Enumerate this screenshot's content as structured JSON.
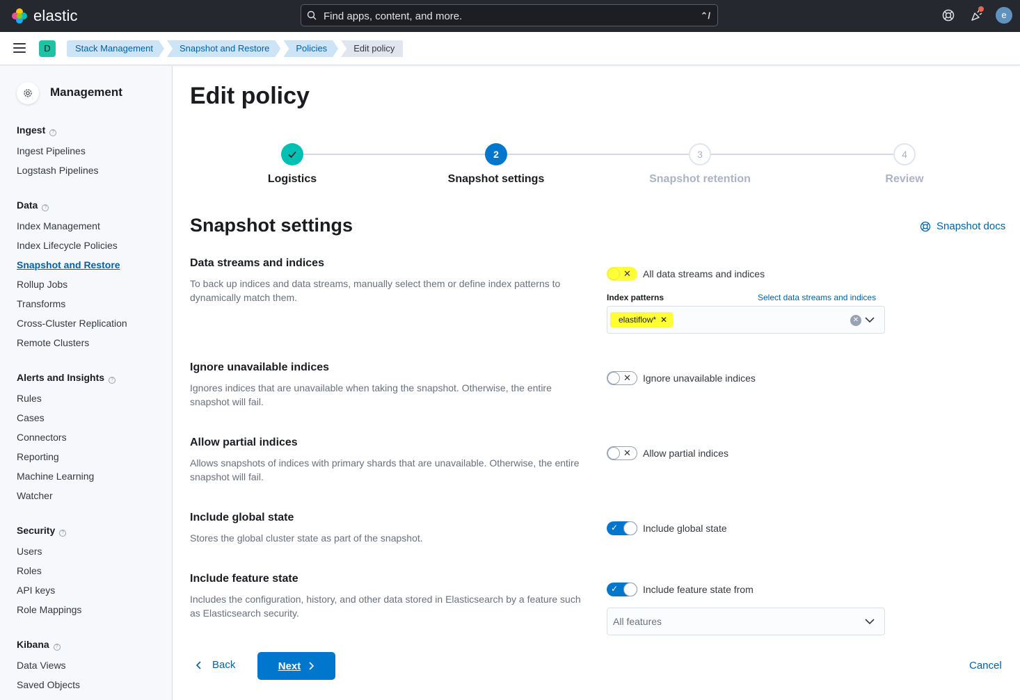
{
  "header": {
    "brand": "elastic",
    "search_placeholder": "Find apps, content, and more.",
    "search_shortcut": "⌃/",
    "avatar_initial": "e",
    "icons": [
      "help-icon",
      "newsfeed-icon",
      "user-avatar"
    ]
  },
  "subbar": {
    "space_initial": "D",
    "breadcrumbs": [
      "Stack Management",
      "Snapshot and Restore",
      "Policies",
      "Edit policy"
    ]
  },
  "sidebar": {
    "title": "Management",
    "groups": [
      {
        "label": "Ingest",
        "items": [
          "Ingest Pipelines",
          "Logstash Pipelines"
        ]
      },
      {
        "label": "Data",
        "items": [
          "Index Management",
          "Index Lifecycle Policies",
          "Snapshot and Restore",
          "Rollup Jobs",
          "Transforms",
          "Cross-Cluster Replication",
          "Remote Clusters"
        ]
      },
      {
        "label": "Alerts and Insights",
        "items": [
          "Rules",
          "Cases",
          "Connectors",
          "Reporting",
          "Machine Learning",
          "Watcher"
        ]
      },
      {
        "label": "Security",
        "items": [
          "Users",
          "Roles",
          "API keys",
          "Role Mappings"
        ]
      },
      {
        "label": "Kibana",
        "items": [
          "Data Views",
          "Saved Objects"
        ]
      }
    ],
    "active_item": "Snapshot and Restore"
  },
  "main": {
    "title": "Edit policy",
    "steps": [
      {
        "number": "1",
        "label": "Logistics",
        "status": "complete"
      },
      {
        "number": "2",
        "label": "Snapshot settings",
        "status": "current"
      },
      {
        "number": "3",
        "label": "Snapshot retention",
        "status": "incomplete"
      },
      {
        "number": "4",
        "label": "Review",
        "status": "incomplete"
      }
    ],
    "section_title": "Snapshot settings",
    "docs_link": "Snapshot docs",
    "rows": {
      "data_streams": {
        "title": "Data streams and indices",
        "description": "To back up indices and data streams, manually select them or define index patterns to dynamically match them.",
        "switch_label": "All data streams and indices",
        "switch_on": false,
        "field_label": "Index patterns",
        "field_link": "Select data streams and indices",
        "patterns": [
          "elastiflow*"
        ]
      },
      "ignore_unavailable": {
        "title": "Ignore unavailable indices",
        "description": "Ignores indices that are unavailable when taking the snapshot. Otherwise, the entire snapshot will fail.",
        "switch_label": "Ignore unavailable indices",
        "switch_on": false
      },
      "partial": {
        "title": "Allow partial indices",
        "description": "Allows snapshots of indices with primary shards that are unavailable. Otherwise, the entire snapshot will fail.",
        "switch_label": "Allow partial indices",
        "switch_on": false
      },
      "global_state": {
        "title": "Include global state",
        "description": "Stores the global cluster state as part of the snapshot.",
        "switch_label": "Include global state",
        "switch_on": true
      },
      "feature_state": {
        "title": "Include feature state",
        "description": "Includes the configuration, history, and other data stored in Elasticsearch by a feature such as Elasticsearch security.",
        "switch_label": "Include feature state from",
        "switch_on": true,
        "select_value": "All features"
      }
    },
    "buttons": {
      "back": "Back",
      "next": "Next",
      "cancel": "Cancel"
    }
  },
  "colors": {
    "header_bg": "#25282f",
    "primary": "#0077cc",
    "link": "#0061a6",
    "success": "#00bfb3",
    "highlight": "#ffff33"
  }
}
